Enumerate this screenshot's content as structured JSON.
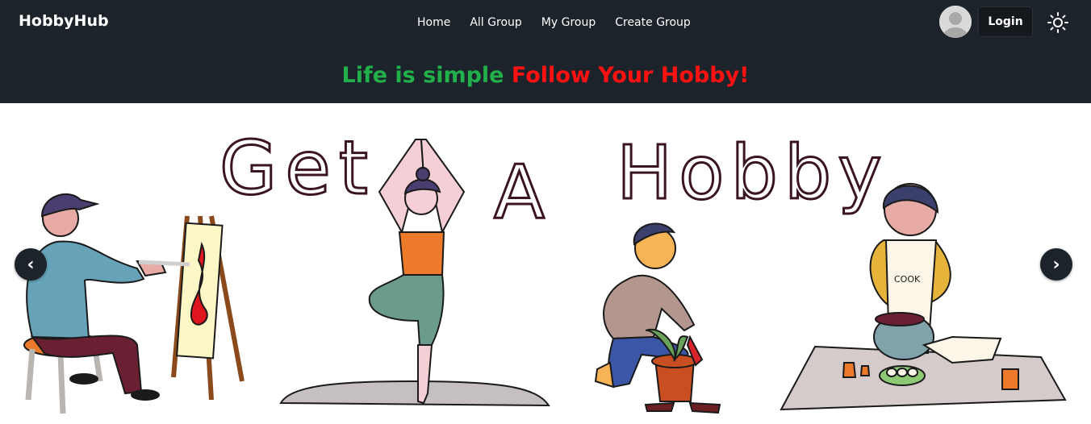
{
  "brand": "HobbyHub",
  "nav": {
    "items": [
      {
        "label": "Home"
      },
      {
        "label": "All Group"
      },
      {
        "label": "My Group"
      },
      {
        "label": "Create Group"
      }
    ],
    "login_label": "Login",
    "avatar_icon": "user-avatar-icon",
    "theme_icon": "sun-icon"
  },
  "tagline": {
    "part1": "Life is simple",
    "part2": "Follow Your Hobby!"
  },
  "carousel": {
    "prev_label": "‹",
    "next_label": "›",
    "slide_text": "Get A Hobby",
    "apron_text": "COOK"
  },
  "colors": {
    "navbar_bg": "#1d232a",
    "tagline_green": "#22b04a",
    "tagline_red": "#ff1111"
  }
}
